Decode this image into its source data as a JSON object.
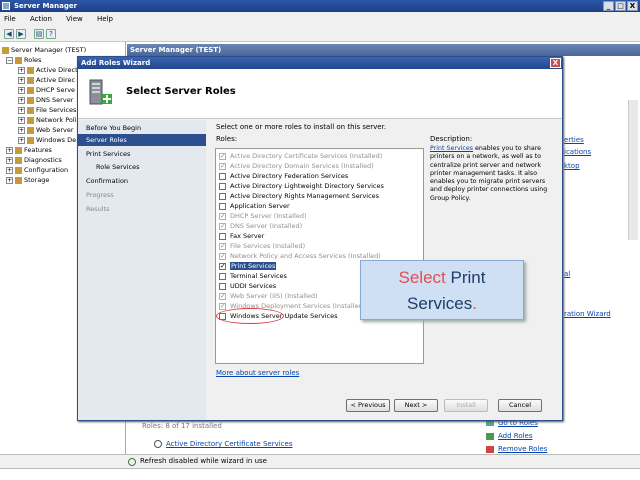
{
  "window": {
    "title": "Server Manager",
    "controls": [
      "_",
      "□",
      "X"
    ]
  },
  "menu": [
    "File",
    "Action",
    "View",
    "Help"
  ],
  "tree": {
    "root": "Server Manager (TEST)",
    "roles_label": "Roles",
    "roles": [
      "Active Directory",
      "Active Direc",
      "DHCP Serve",
      "DNS Server",
      "File Services",
      "Network Poli",
      "Web Server",
      "Windows De"
    ],
    "other": [
      "Features",
      "Diagnostics",
      "Configuration",
      "Storage"
    ]
  },
  "right_header": "Server Manager (TEST)",
  "right_side_links": [
    "erties",
    "ications",
    "ktop",
    "al",
    "ration Wizard"
  ],
  "bottom": {
    "roles_summary": "Roles: 8 of 17 installed",
    "ad_cert": "Active Directory Certificate Services",
    "goto_roles": "Go to Roles",
    "add_roles": "Add Roles",
    "remove_roles": "Remove Roles"
  },
  "status": "Refresh disabled while wizard in use",
  "wizard": {
    "title": "Add Roles Wizard",
    "heading": "Select Server Roles",
    "steps": [
      {
        "label": "Before You Begin",
        "state": "normal"
      },
      {
        "label": "Server Roles",
        "state": "active"
      },
      {
        "label": "Print Services",
        "state": "normal"
      },
      {
        "label": "Role Services",
        "state": "sub"
      },
      {
        "label": "Confirmation",
        "state": "normal"
      },
      {
        "label": "Progress",
        "state": "dim"
      },
      {
        "label": "Results",
        "state": "dim"
      }
    ],
    "instruction": "Select one or more roles to install on this server.",
    "roles_label": "Roles:",
    "roles": [
      {
        "label": "Active Directory Certificate Services  (Installed)",
        "checked": true,
        "installed": true
      },
      {
        "label": "Active Directory Domain Services  (Installed)",
        "checked": true,
        "installed": true
      },
      {
        "label": "Active Directory Federation Services",
        "checked": false,
        "installed": false
      },
      {
        "label": "Active Directory Lightweight Directory Services",
        "checked": false,
        "installed": false
      },
      {
        "label": "Active Directory Rights Management Services",
        "checked": false,
        "installed": false
      },
      {
        "label": "Application Server",
        "checked": false,
        "installed": false
      },
      {
        "label": "DHCP Server  (Installed)",
        "checked": true,
        "installed": true
      },
      {
        "label": "DNS Server  (Installed)",
        "checked": true,
        "installed": true
      },
      {
        "label": "Fax Server",
        "checked": false,
        "installed": false
      },
      {
        "label": "File Services  (Installed)",
        "checked": true,
        "installed": true
      },
      {
        "label": "Network Policy and Access Services  (Installed)",
        "checked": true,
        "installed": true
      },
      {
        "label": "Print Services",
        "checked": true,
        "installed": false,
        "selected": true
      },
      {
        "label": "Terminal Services",
        "checked": false,
        "installed": false
      },
      {
        "label": "UDDI Services",
        "checked": false,
        "installed": false
      },
      {
        "label": "Web Server (IIS)  (Installed)",
        "checked": true,
        "installed": true
      },
      {
        "label": "Windows Deployment Services  (Installed)",
        "checked": true,
        "installed": true
      },
      {
        "label": "Windows Server Update Services",
        "checked": false,
        "installed": false
      }
    ],
    "description_label": "Description:",
    "description_link": "Print Services",
    "description_text": " enables you to share printers on a network, as well as to centralize print server and network printer management tasks. It also enables you to migrate print servers and deploy printer connections using Group Policy.",
    "more_link": "More about server roles",
    "buttons": {
      "previous": "< Previous",
      "next": "Next >",
      "install": "Install",
      "cancel": "Cancel"
    }
  },
  "callout": {
    "word1": "Select",
    "word2": "Print",
    "word3": "Services",
    "dot": "."
  }
}
